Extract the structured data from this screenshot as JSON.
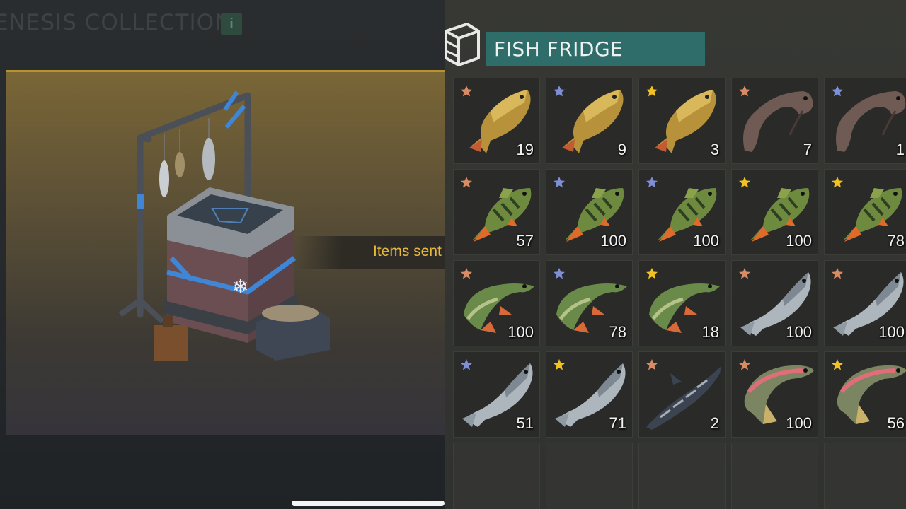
{
  "left": {
    "title": "ENESIS COLLECTION",
    "info_label": "i",
    "notification": "Items sent"
  },
  "fridge": {
    "title": "FISH FRIDGE",
    "rows": [
      [
        {
          "fish": "carp",
          "star": "bronze",
          "count": "19"
        },
        {
          "fish": "carp",
          "star": "blue",
          "count": "9"
        },
        {
          "fish": "carp",
          "star": "gold",
          "count": "3"
        },
        {
          "fish": "catfish",
          "star": "bronze",
          "count": "7"
        },
        {
          "fish": "catfish",
          "star": "blue",
          "count": "1"
        }
      ],
      [
        {
          "fish": "perch",
          "star": "bronze",
          "count": "57"
        },
        {
          "fish": "perch",
          "star": "blue",
          "count": "100"
        },
        {
          "fish": "perch",
          "star": "blue",
          "count": "100"
        },
        {
          "fish": "perch",
          "star": "gold",
          "count": "100"
        },
        {
          "fish": "perch",
          "star": "gold",
          "count": "78"
        }
      ],
      [
        {
          "fish": "pike",
          "star": "bronze",
          "count": "100"
        },
        {
          "fish": "pike",
          "star": "blue",
          "count": "78"
        },
        {
          "fish": "pike",
          "star": "gold",
          "count": "18"
        },
        {
          "fish": "salmon",
          "star": "bronze",
          "count": "100"
        },
        {
          "fish": "salmon",
          "star": "bronze",
          "count": "100"
        }
      ],
      [
        {
          "fish": "salmon",
          "star": "blue",
          "count": "51"
        },
        {
          "fish": "salmon",
          "star": "gold",
          "count": "71"
        },
        {
          "fish": "sturgeon",
          "star": "bronze",
          "count": "2"
        },
        {
          "fish": "trout",
          "star": "bronze",
          "count": "100"
        },
        {
          "fish": "trout",
          "star": "gold",
          "count": "56"
        }
      ]
    ],
    "empty_slots": 5
  },
  "colors": {
    "bronze": "#d98b63",
    "blue": "#7f8fd6",
    "gold": "#f2c320",
    "accent": "#2f6d6a"
  }
}
